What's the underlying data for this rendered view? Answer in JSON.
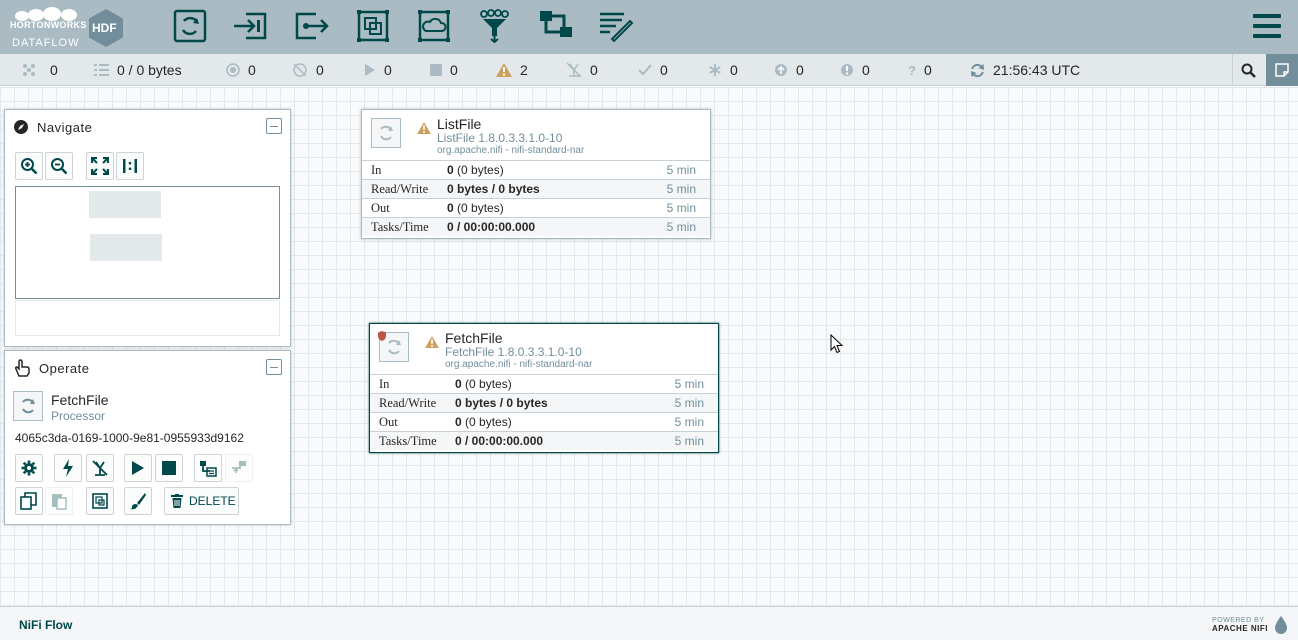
{
  "brand": {
    "company": "HORTONWORKS",
    "product": "DATAFLOW",
    "badge": "HDF"
  },
  "toolbar": [
    {
      "name": "processor-tool",
      "icon": "processor-icon"
    },
    {
      "name": "input-port-tool",
      "icon": "input-port-icon"
    },
    {
      "name": "output-port-tool",
      "icon": "output-port-icon"
    },
    {
      "name": "process-group-tool",
      "icon": "process-group-icon"
    },
    {
      "name": "remote-process-group-tool",
      "icon": "remote-process-group-icon"
    },
    {
      "name": "funnel-tool",
      "icon": "funnel-icon"
    },
    {
      "name": "template-tool",
      "icon": "template-icon"
    },
    {
      "name": "label-tool",
      "icon": "label-icon"
    }
  ],
  "status": {
    "active_threads": "0",
    "queued": "0 / 0 bytes",
    "transmitting": "0",
    "not_transmitting": "0",
    "running": "0",
    "stopped": "0",
    "invalid": "2",
    "disabled": "0",
    "up_to_date": "0",
    "locally_modified": "0",
    "stale": "0",
    "sync_failure": "0",
    "unknown": "0",
    "refresh_time": "21:56:43 UTC"
  },
  "navigate": {
    "title": "Navigate"
  },
  "operate": {
    "title": "Operate",
    "component_name": "FetchFile",
    "component_type": "Processor",
    "component_id": "4065c3da-0169-1000-9e81-0955933d9162",
    "delete_label": "DELETE"
  },
  "processors": [
    {
      "name": "ListFile",
      "type": "ListFile 1.8.0.3.3.1.0-10",
      "bundle": "org.apache.nifi - nifi-standard-nar",
      "stats": [
        {
          "label": "In",
          "value_bold": "0",
          "value_rest": " (0 bytes)",
          "time": "5 min"
        },
        {
          "label": "Read/Write",
          "value_bold": "0 bytes / 0 bytes",
          "value_rest": "",
          "time": "5 min"
        },
        {
          "label": "Out",
          "value_bold": "0",
          "value_rest": " (0 bytes)",
          "time": "5 min"
        },
        {
          "label": "Tasks/Time",
          "value_bold": "0 / 00:00:00.000",
          "value_rest": "",
          "time": "5 min"
        }
      ]
    },
    {
      "name": "FetchFile",
      "type": "FetchFile 1.8.0.3.3.1.0-10",
      "bundle": "org.apache.nifi - nifi-standard-nar",
      "stats": [
        {
          "label": "In",
          "value_bold": "0",
          "value_rest": " (0 bytes)",
          "time": "5 min"
        },
        {
          "label": "Read/Write",
          "value_bold": "0 bytes / 0 bytes",
          "value_rest": "",
          "time": "5 min"
        },
        {
          "label": "Out",
          "value_bold": "0",
          "value_rest": " (0 bytes)",
          "time": "5 min"
        },
        {
          "label": "Tasks/Time",
          "value_bold": "0 / 00:00:00.000",
          "value_rest": "",
          "time": "5 min"
        }
      ]
    }
  ],
  "footer": {
    "breadcrumb": "NiFi Flow",
    "powered_line1": "POWERED BY",
    "powered_line2": "APACHE NIFI"
  },
  "colors": {
    "header": "#aabbc3",
    "dark_teal": "#004849",
    "muted": "#728e9b",
    "warning": "#cf9f5d"
  }
}
